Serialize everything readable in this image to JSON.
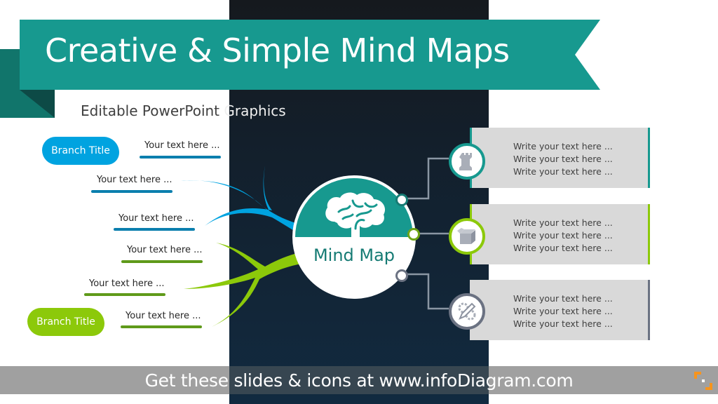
{
  "slide": {
    "title": "Creative & Simple Mind Maps",
    "subtitle_part1": "Editable PowerPoint",
    "subtitle_part2": " Graphics"
  },
  "colors": {
    "teal": "#17998f",
    "teal_dark": "#11756b",
    "teal_darker": "#0d4a46",
    "navy_top": "#15191e",
    "navy_bottom": "#112a40",
    "blue": "#00a3e0",
    "blue_line": "#0b7fae",
    "green": "#8cc90a",
    "green_line": "#5f9a1a",
    "slate": "#6b7282",
    "box_gray": "#d9d9d9",
    "footer_gray": "#a0a0a0",
    "logo_orange": "#f7941d"
  },
  "left_branches": [
    {
      "color": "blue",
      "title": "Branch Title",
      "leaves": [
        {
          "text": "Your text here ..."
        },
        {
          "text": "Your text here ..."
        },
        {
          "text": "Your text here ..."
        }
      ]
    },
    {
      "color": "green",
      "title": "Branch Title",
      "leaves": [
        {
          "text": "Your text here ..."
        },
        {
          "text": "Your text here ..."
        },
        {
          "text": "Your text here ..."
        }
      ]
    }
  ],
  "center": {
    "label": "Mind Map",
    "icon": "brain-icon"
  },
  "right_items": [
    {
      "icon": "chess-rook-icon",
      "accent": "teal",
      "lines": [
        "Write your text here ...",
        "Write your text here ...",
        "Write your text here ..."
      ]
    },
    {
      "icon": "open-box-icon",
      "accent": "green",
      "lines": [
        "Write your text here ...",
        "Write your text here ...",
        "Write your text here ..."
      ]
    },
    {
      "icon": "gear-pencil-icon",
      "accent": "slate",
      "lines": [
        "Write your text here ...",
        "Write your text here ...",
        "Write your text here ..."
      ]
    }
  ],
  "footer": {
    "text": "Get these slides & icons at www.infoDiagram.com",
    "logo": "infodiagram-logo-icon"
  }
}
